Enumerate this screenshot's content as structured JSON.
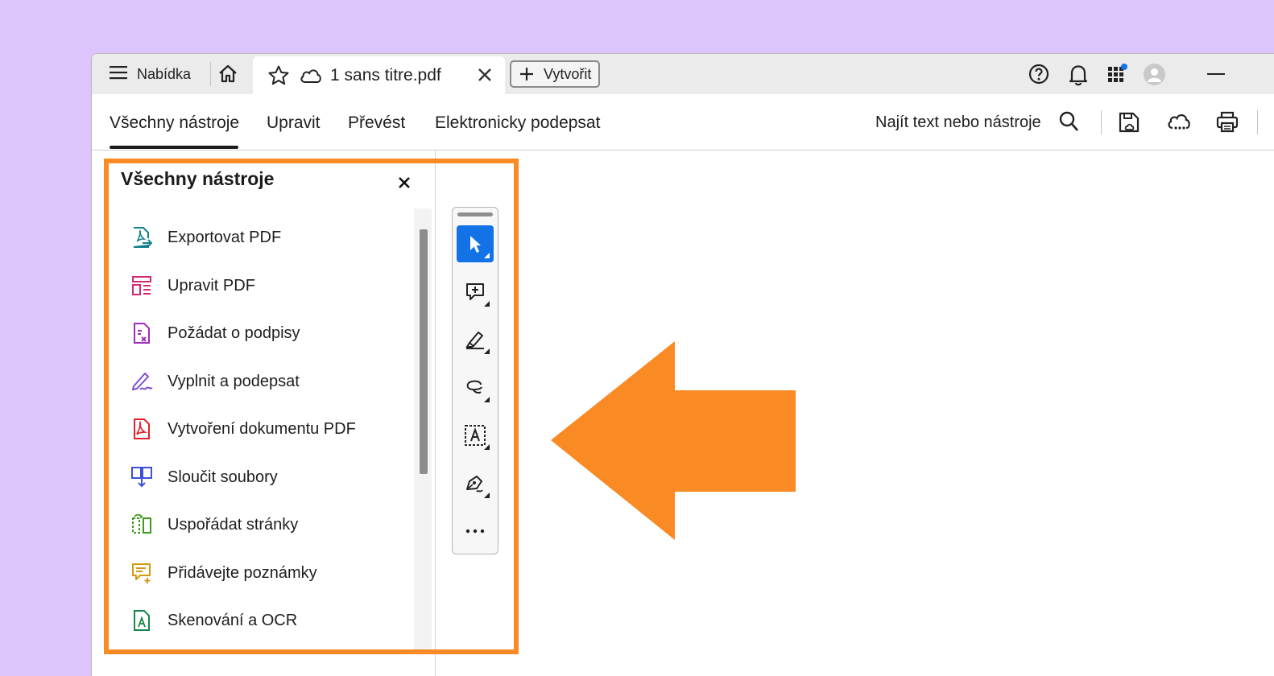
{
  "titlebar": {
    "menu_label": "Nabídka",
    "tab_title": "1 sans titre.pdf",
    "create_label": "Vytvořit"
  },
  "toolbar": {
    "tabs": [
      {
        "label": "Všechny nástroje",
        "active": true
      },
      {
        "label": "Upravit"
      },
      {
        "label": "Převést"
      },
      {
        "label": "Elektronicky podepsat"
      }
    ],
    "search_label": "Najít text nebo nástroje"
  },
  "panel": {
    "title": "Všechny nástroje",
    "tools": [
      {
        "label": "Exportovat PDF",
        "icon": "export-pdf-icon",
        "color": "#12808c"
      },
      {
        "label": "Upravit PDF",
        "icon": "edit-pdf-icon",
        "color": "#d12a72"
      },
      {
        "label": "Požádat o podpisy",
        "icon": "request-signatures-icon",
        "color": "#a02bbd"
      },
      {
        "label": "Vyplnit a podepsat",
        "icon": "fill-sign-icon",
        "color": "#7d4ed8"
      },
      {
        "label": "Vytvoření dokumentu PDF",
        "icon": "create-pdf-icon",
        "color": "#e0212b"
      },
      {
        "label": "Sloučit soubory",
        "icon": "combine-files-icon",
        "color": "#3b50d6"
      },
      {
        "label": "Uspořádat stránky",
        "icon": "organize-pages-icon",
        "color": "#3f9a1c"
      },
      {
        "label": "Přidávejte poznámky",
        "icon": "add-comments-icon",
        "color": "#d49a0e"
      },
      {
        "label": "Skenování a OCR",
        "icon": "scan-ocr-icon",
        "color": "#17854a"
      }
    ]
  },
  "quick_tools": [
    "select-cursor-icon",
    "add-comment-icon",
    "highlight-pen-icon",
    "draw-lasso-icon",
    "text-select-icon",
    "sign-pen-icon",
    "more-icon"
  ],
  "colors": {
    "background": "#dcc4fc",
    "highlight": "#f98a24",
    "accent": "#1373e6"
  }
}
